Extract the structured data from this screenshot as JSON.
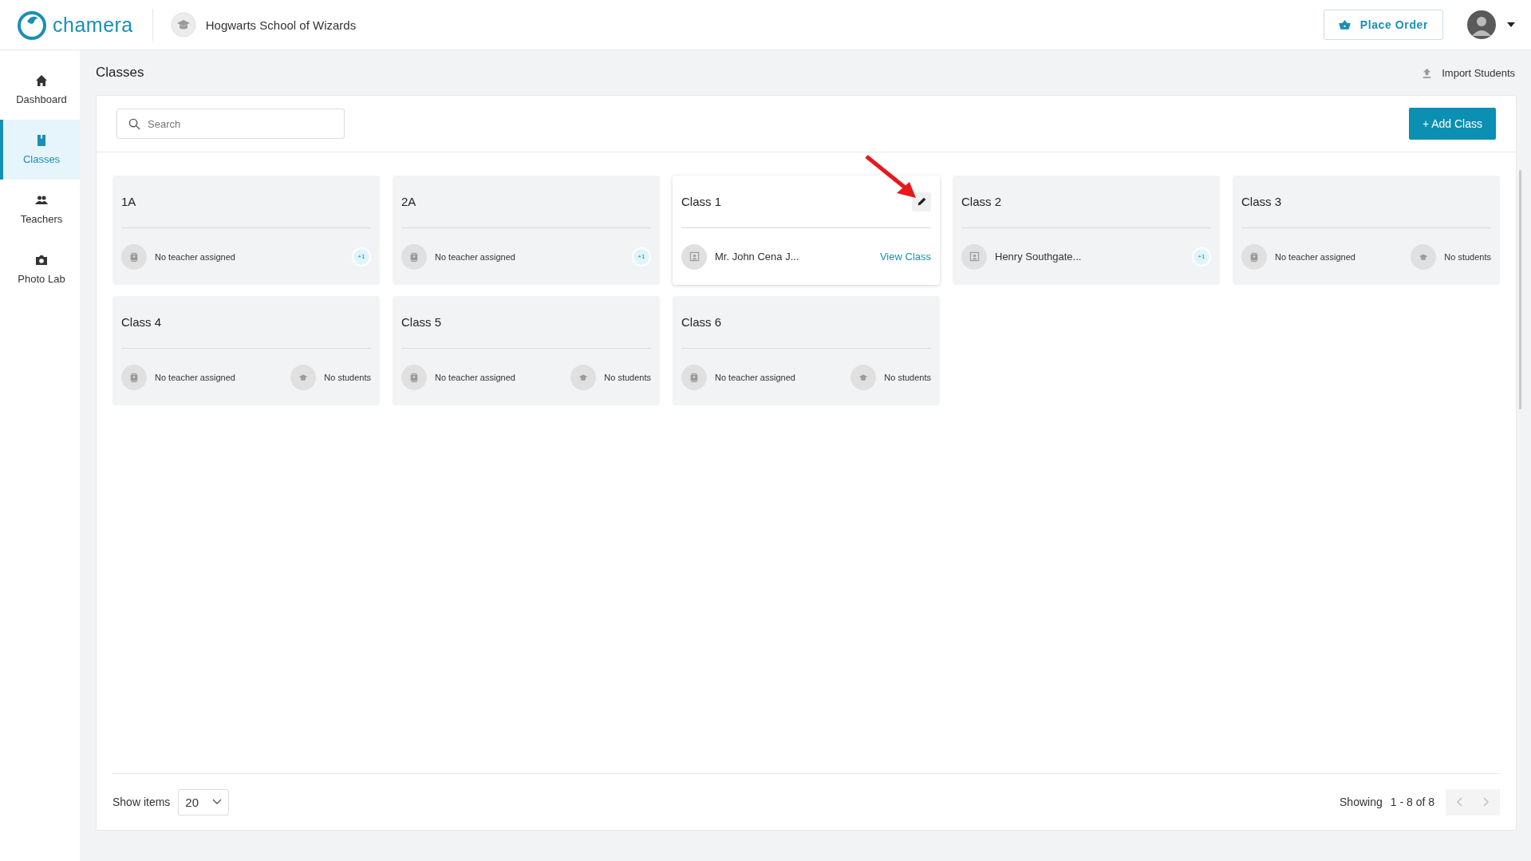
{
  "brand": {
    "name": "chamera"
  },
  "school": {
    "name": "Hogwarts School of Wizards"
  },
  "header": {
    "place_order": "Place Order"
  },
  "sidebar": {
    "items": [
      {
        "label": "Dashboard",
        "kind": "home",
        "selected": false
      },
      {
        "label": "Classes",
        "kind": "book",
        "selected": true
      },
      {
        "label": "Teachers",
        "kind": "people",
        "selected": false
      },
      {
        "label": "Photo Lab",
        "kind": "camera",
        "selected": false
      }
    ]
  },
  "page": {
    "title": "Classes",
    "import_action": "Import Students"
  },
  "toolbar": {
    "search": {
      "placeholder": "Search"
    },
    "add_button": "+ Add Class"
  },
  "cards": [
    {
      "name": "1A",
      "teacher": "No teacher assigned",
      "teacher_assigned": false,
      "hovered": false,
      "right": {
        "kind": "badge",
        "text": "+1"
      }
    },
    {
      "name": "2A",
      "teacher": "No teacher assigned",
      "teacher_assigned": false,
      "hovered": false,
      "right": {
        "kind": "badge",
        "text": "+1"
      }
    },
    {
      "name": "Class 1",
      "teacher": "Mr. John Cena J...",
      "teacher_assigned": true,
      "hovered": true,
      "right": {
        "kind": "link",
        "text": "View Class"
      }
    },
    {
      "name": "Class 2",
      "teacher": "Henry Southgate...",
      "teacher_assigned": true,
      "hovered": false,
      "right": {
        "kind": "badge",
        "text": "+1"
      }
    },
    {
      "name": "Class 3",
      "teacher": "No teacher assigned",
      "teacher_assigned": false,
      "hovered": false,
      "right": {
        "kind": "students",
        "text": "No students"
      }
    },
    {
      "name": "Class 4",
      "teacher": "No teacher assigned",
      "teacher_assigned": false,
      "hovered": false,
      "right": {
        "kind": "students",
        "text": "No students"
      }
    },
    {
      "name": "Class 5",
      "teacher": "No teacher assigned",
      "teacher_assigned": false,
      "hovered": false,
      "right": {
        "kind": "students",
        "text": "No students"
      }
    },
    {
      "name": "Class 6",
      "teacher": "No teacher assigned",
      "teacher_assigned": false,
      "hovered": false,
      "right": {
        "kind": "students",
        "text": "No students"
      }
    }
  ],
  "footer": {
    "show_items_label": "Show items",
    "page_size": "20",
    "showing_label": "Showing",
    "range": "1 - 8 of 8"
  }
}
